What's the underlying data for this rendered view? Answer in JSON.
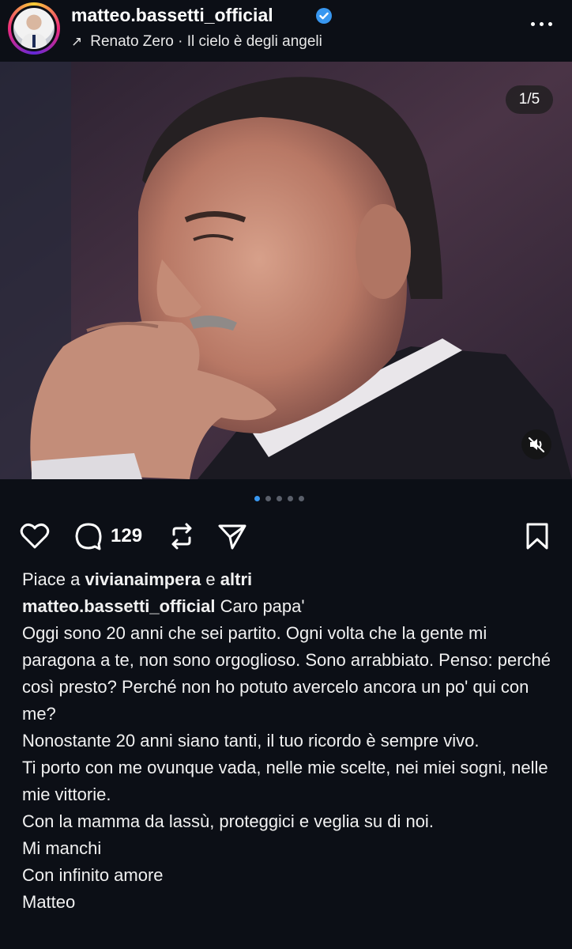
{
  "post": {
    "username": "matteo.bassetti_official",
    "music": "Renato Zero · Il cielo è degli angeli",
    "slide_counter": "1/5",
    "comment_count": "129",
    "total_slides": 5,
    "active_slide": 1
  },
  "likes": {
    "prefix": "Piace a",
    "user": "vivianaimpera",
    "connector": "e",
    "others": "altri"
  },
  "caption": {
    "author": "matteo.bassetti_official",
    "first": "Caro papa'",
    "lines": [
      "Oggi sono 20 anni che sei partito. Ogni volta che la gente mi paragona a te, non sono orgoglioso. Sono arrabbiato. Penso: perché così presto? Perché non ho potuto avercelo ancora un po' qui con me?",
      "Nonostante 20 anni siano tanti, il tuo ricordo è sempre vivo.",
      "Ti porto con me ovunque vada, nelle mie scelte, nei miei sogni, nelle mie vittorie.",
      "Con la mamma da lassù, proteggici e veglia su di noi.",
      "Mi manchi",
      "Con infinito amore",
      "Matteo"
    ]
  },
  "icons": {
    "verified": "verified-badge-icon",
    "more": "more-options-icon",
    "like": "heart-icon",
    "comment": "comment-bubble-icon",
    "repost": "repost-icon",
    "share": "send-icon",
    "save": "bookmark-icon",
    "mute": "muted-speaker-icon"
  },
  "colors": {
    "background": "#0c0f16",
    "verified": "#3897f0",
    "active_dot": "#3897f0"
  }
}
